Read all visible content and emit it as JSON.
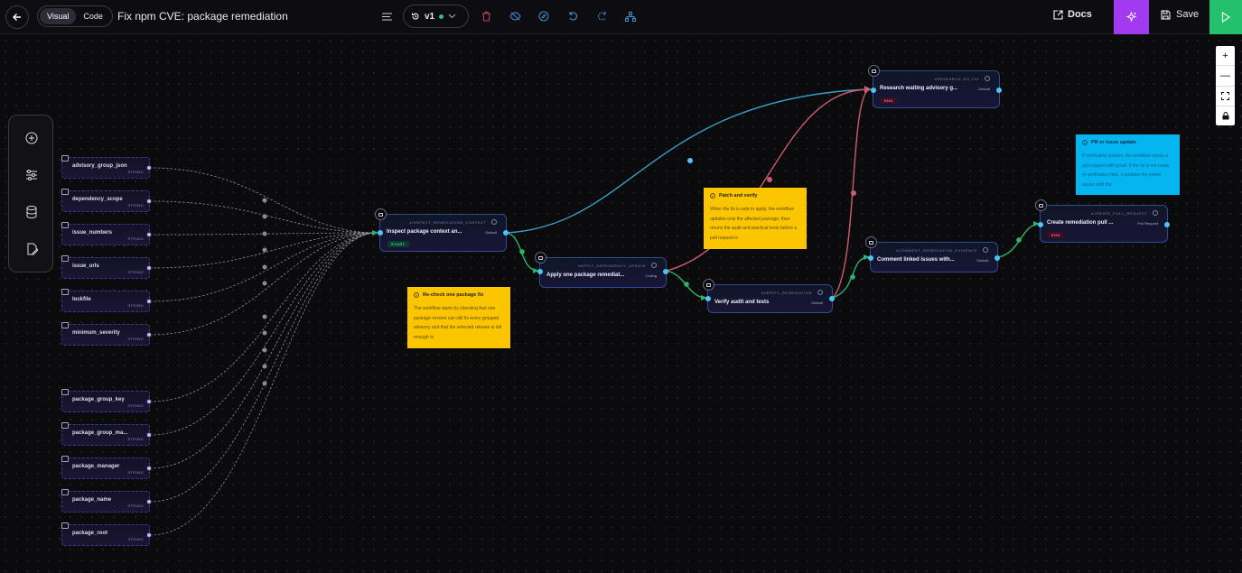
{
  "header": {
    "view_modes": [
      "Visual",
      "Code"
    ],
    "active_view": "Visual",
    "title": "Fix npm CVE: package remediation",
    "version": "v1",
    "docs_label": "Docs",
    "save_label": "Save"
  },
  "zoom_controls": [
    "+",
    "—",
    "fit",
    "lock"
  ],
  "inputs": [
    {
      "name": "advisory_group_json",
      "type": "STRING"
    },
    {
      "name": "dependency_scope",
      "type": "STRING"
    },
    {
      "name": "issue_numbers",
      "type": "STRING"
    },
    {
      "name": "issue_urls",
      "type": "STRING"
    },
    {
      "name": "lockfile",
      "type": "STRING"
    },
    {
      "name": "minimum_severity",
      "type": "STRING"
    },
    {
      "name": "package_group_key",
      "type": "STRING"
    },
    {
      "name": "package_group_ma...",
      "type": "STRING"
    },
    {
      "name": "package_manager",
      "type": "STRING"
    },
    {
      "name": "package_name",
      "type": "STRING"
    },
    {
      "name": "package_root",
      "type": "STRING"
    }
  ],
  "nodes": {
    "inspect": {
      "id": "#INSPECT_REMEDIATION_CONTEXT",
      "name": "Inspect package context an...",
      "meta": "Default",
      "tag": "START"
    },
    "apply": {
      "id": "#APPLY_DEPENDENCY_UPDATE",
      "name": "Apply one package remediat...",
      "meta": "Coding"
    },
    "verify": {
      "id": "#VERIFY_REMEDIATION",
      "name": "Verify audit and tests",
      "meta": "Default"
    },
    "research": {
      "id": "#RESEARCH_NO_FIX",
      "name": "Research waiting advisory g...",
      "meta": "Default",
      "tag": "END"
    },
    "comment": {
      "id": "#COMMENT_REMEDIATION_EVIDENCE",
      "name": "Comment linked issues with...",
      "meta": "Default"
    },
    "pr": {
      "id": "#CREATE_PULL_REQUEST",
      "name": "Create remediation pull ...",
      "meta": "Pull Request",
      "tag": "END"
    }
  },
  "notes": {
    "recheck": {
      "title": "Re-check one package fix",
      "body": "The workflow starts by checking that one package version can still fix every grouped advisory and that the selected release is old enough to"
    },
    "patch": {
      "title": "Patch and verify",
      "body": "When the fix is safe to apply, the workflow updates only the affected package, then reruns the audit and practical tests before a pull request is"
    },
    "pr_issue": {
      "title": "PR or issue update",
      "body": "If verification passes, the workflow opens a pull request with proof. If the fix is not ready or verification fails, it updates the linked issues with the"
    }
  },
  "colors": {
    "edge_blue": "#3a9fc4",
    "edge_red": "#d05b6e",
    "edge_green": "#2fb36a",
    "note_yellow": "#fbc600",
    "note_blue": "#04b5f0",
    "ai_button": "#a23bf0",
    "run_button": "#23c06e"
  }
}
